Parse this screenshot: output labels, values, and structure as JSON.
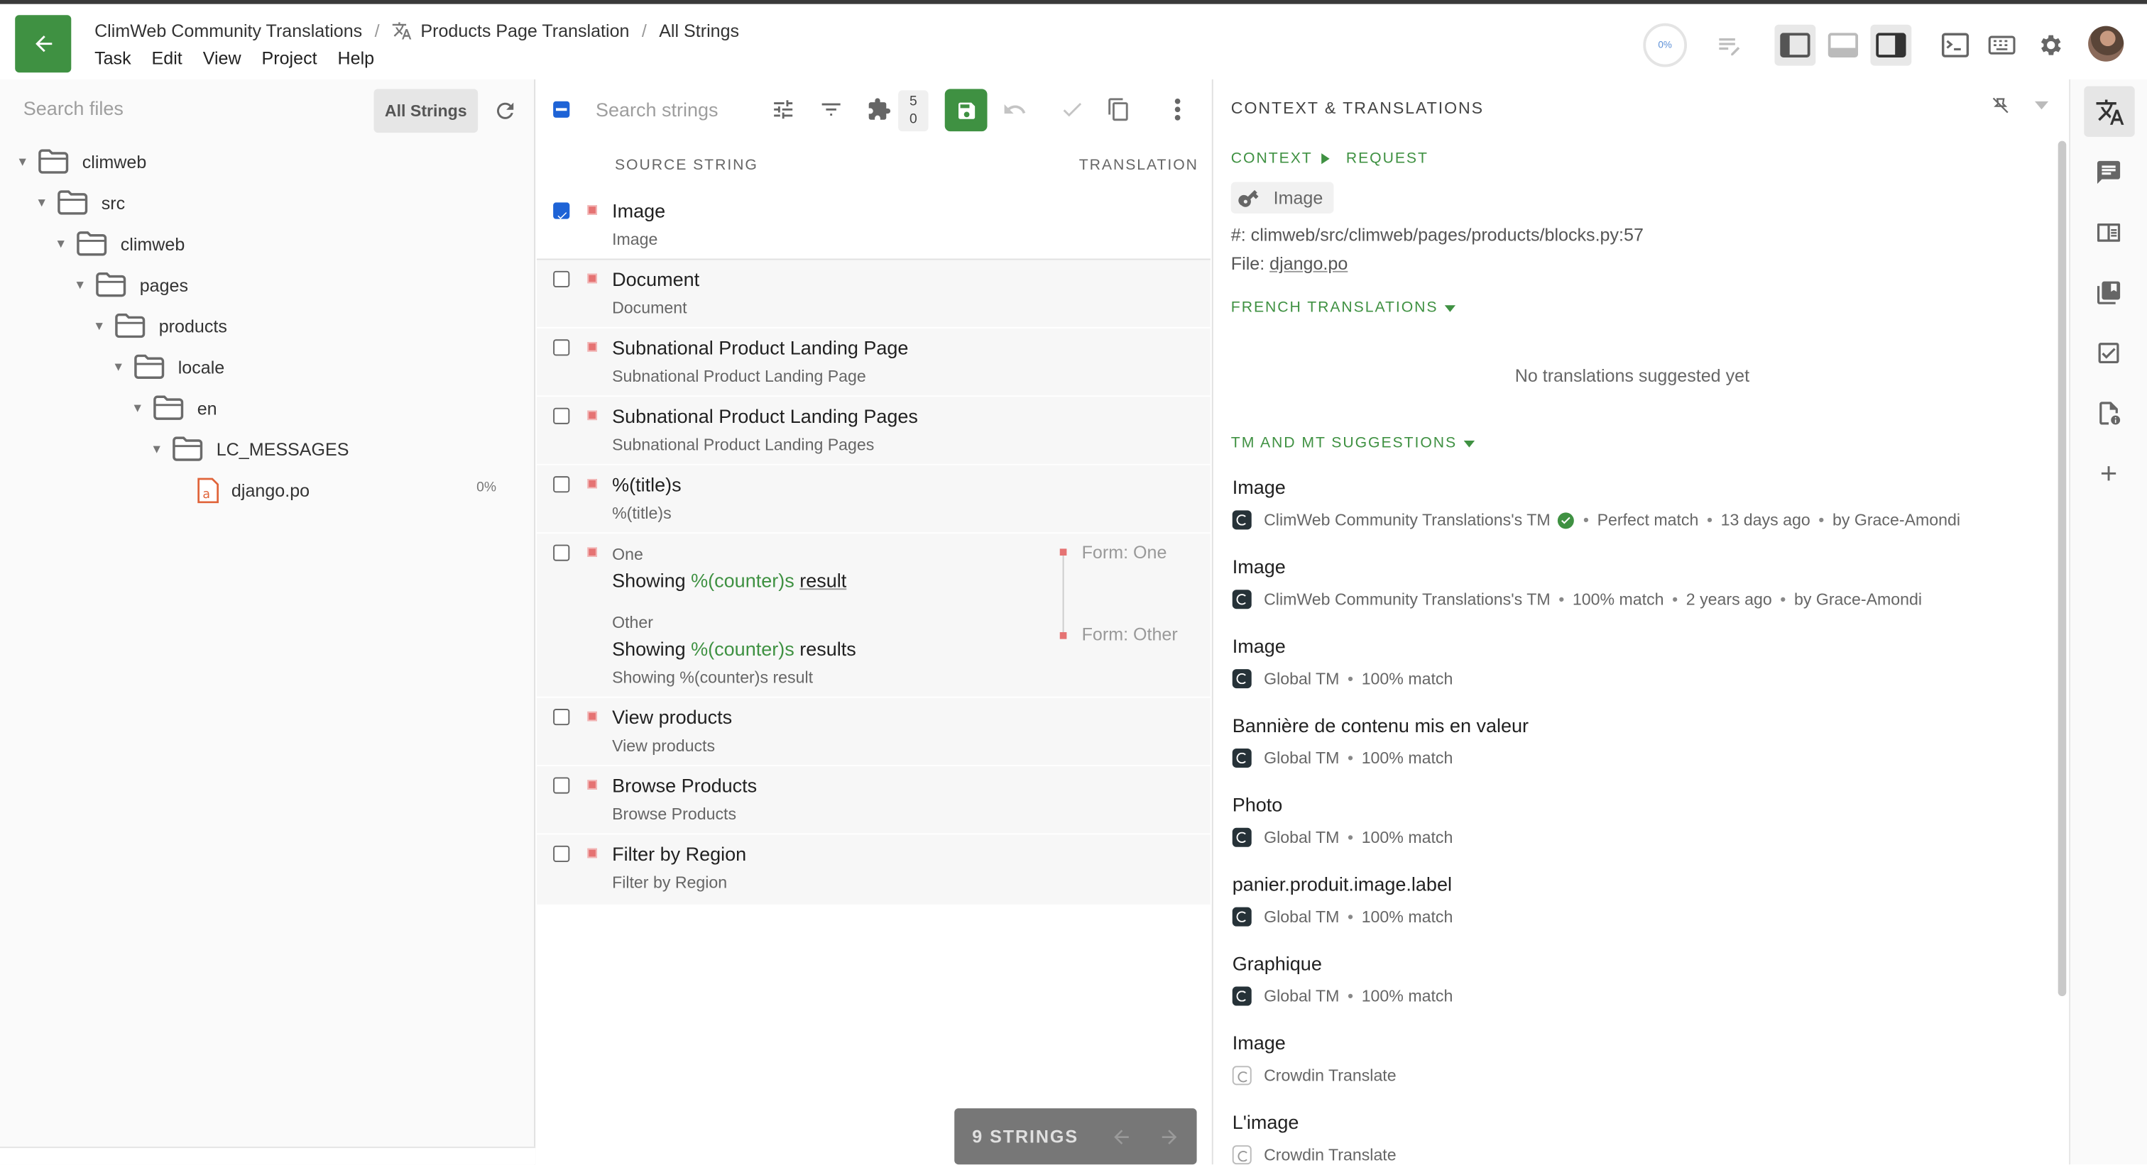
{
  "topbar": {
    "breadcrumb": {
      "project": "ClimWeb Community Translations",
      "file": "Products Page Translation",
      "view": "All Strings"
    },
    "menu": [
      "Task",
      "Edit",
      "View",
      "Project",
      "Help"
    ],
    "progress": "0%",
    "accent_color": "#3f9142"
  },
  "files": {
    "search_placeholder": "Search files",
    "filter_label": "All Strings",
    "tree": [
      {
        "label": "climweb",
        "depth": 0
      },
      {
        "label": "src",
        "depth": 1
      },
      {
        "label": "climweb",
        "depth": 2
      },
      {
        "label": "pages",
        "depth": 3
      },
      {
        "label": "products",
        "depth": 4
      },
      {
        "label": "locale",
        "depth": 5
      },
      {
        "label": "en",
        "depth": 6
      },
      {
        "label": "LC_MESSAGES",
        "depth": 7
      }
    ],
    "file": {
      "label": "django.po",
      "progress": "0%"
    }
  },
  "strings": {
    "search_placeholder": "Search strings",
    "badge_top": "5",
    "badge_bottom": "0",
    "col_source": "SOURCE STRING",
    "col_translation": "TRANSLATION",
    "rows": [
      {
        "source": "Image",
        "sub": "Image",
        "checked": true
      },
      {
        "source": "Document",
        "sub": "Document"
      },
      {
        "source": "Subnational Product Landing Page",
        "sub": "Subnational Product Landing Page"
      },
      {
        "source": "Subnational Product Landing Pages",
        "sub": "Subnational Product Landing Pages"
      },
      {
        "source": "%(title)s",
        "sub": "%(title)s"
      },
      {
        "plural_one_label": "One",
        "one_pre": "Showing ",
        "one_ph": "%(counter)s",
        "one_post": "result",
        "plural_other_label": "Other",
        "other_pre": "Showing ",
        "other_ph": "%(counter)s",
        "other_post": "results",
        "sub": "Showing %(counter)s result",
        "form_one": "Form: One",
        "form_other": "Form: Other"
      },
      {
        "source": "View products",
        "sub": "View products"
      },
      {
        "source": "Browse Products",
        "sub": "Browse Products"
      },
      {
        "source": "Filter by Region",
        "sub": "Filter by Region"
      }
    ],
    "footer_label": "9 STRINGS"
  },
  "context": {
    "panel_title": "CONTEXT & TRANSLATIONS",
    "context_label": "CONTEXT",
    "request_label": "REQUEST",
    "key": "Image",
    "path": "#: climweb/src/climweb/pages/products/blocks.py:57",
    "file_prefix": "File: ",
    "file_name": "django.po",
    "french_header": "FRENCH TRANSLATIONS",
    "empty_text": "No translations suggested yet",
    "tm_header": "TM AND MT SUGGESTIONS",
    "suggestions": [
      {
        "text": "Image",
        "source": "ClimWeb Community Translations's TM",
        "verified": true,
        "match": "Perfect match",
        "age": "13 days ago",
        "by": "by Grace-Amondi"
      },
      {
        "text": "Image",
        "source": "ClimWeb Community Translations's TM",
        "match": "100% match",
        "age": "2 years ago",
        "by": "by Grace-Amondi"
      },
      {
        "text": "Image",
        "source": "Global TM",
        "match": "100% match"
      },
      {
        "text": "Bannière de contenu mis en valeur",
        "source": "Global TM",
        "match": "100% match"
      },
      {
        "text": "Photo",
        "source": "Global TM",
        "match": "100% match"
      },
      {
        "text": "panier.produit.image.label",
        "source": "Global TM",
        "match": "100% match"
      },
      {
        "text": "Graphique",
        "source": "Global TM",
        "match": "100% match"
      },
      {
        "text": "Image",
        "source": "Crowdin Translate",
        "mt": true
      },
      {
        "text": "L'image",
        "source": "Crowdin Translate",
        "mt": true
      }
    ]
  }
}
